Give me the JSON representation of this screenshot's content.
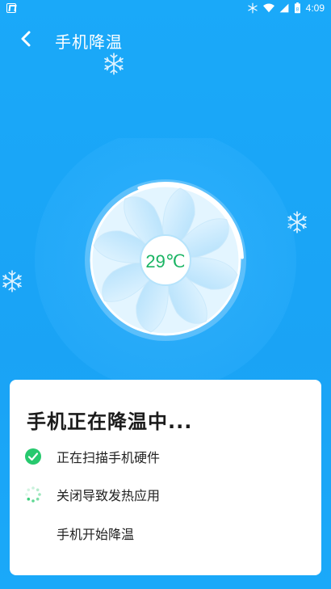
{
  "status_bar": {
    "time": "4:09",
    "battery_level": "8",
    "icons": [
      "app-notification-icon",
      "snowflake-icon",
      "wifi-icon",
      "signal-icon",
      "battery-icon"
    ]
  },
  "header": {
    "back_icon": "chevron-left-icon",
    "title": "手机降温"
  },
  "fan": {
    "temperature": "29℃",
    "progress": 0.3
  },
  "card": {
    "title": "手机正在降温中...",
    "steps": [
      {
        "label": "正在扫描手机硬件",
        "state": "done",
        "icon": "check-circle-icon"
      },
      {
        "label": "关闭导致发热应用",
        "state": "in-progress",
        "icon": "loading-spinner-icon"
      },
      {
        "label": "手机开始降温",
        "state": "pending",
        "icon": ""
      }
    ]
  },
  "colors": {
    "background": "#1aa9f9",
    "accent_green": "#27c96e",
    "fan_blade": "#bfe7ff",
    "card_bg": "#ffffff"
  }
}
